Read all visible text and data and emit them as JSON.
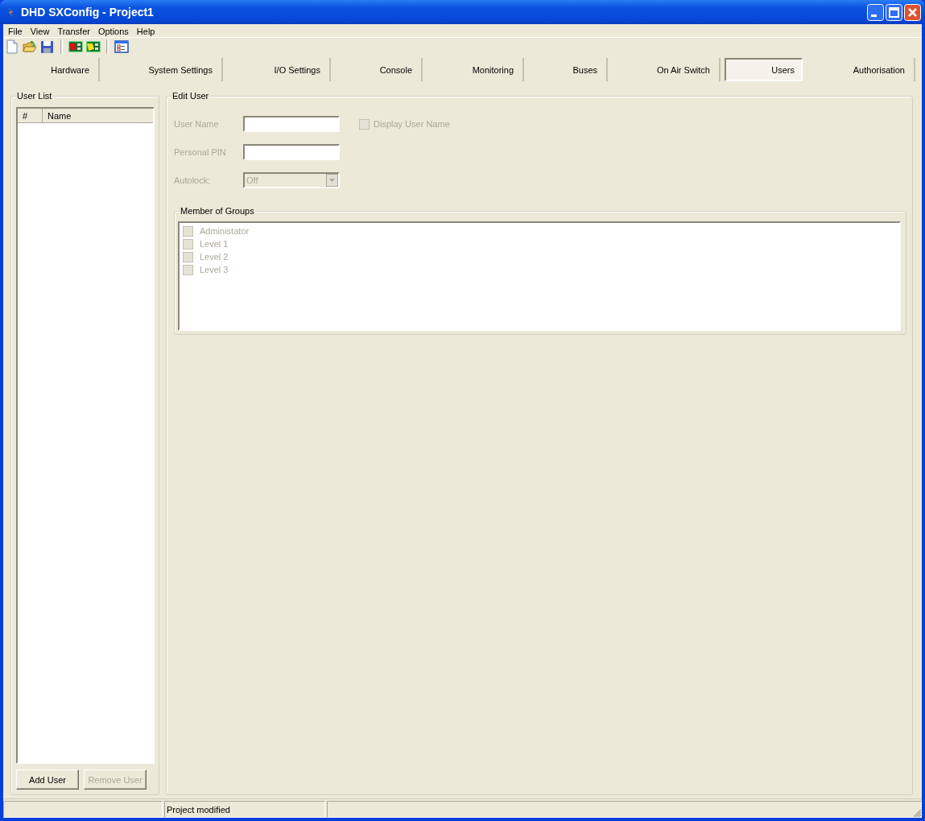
{
  "window": {
    "title": "DHD SXConfig - Project1"
  },
  "menu": [
    "File",
    "View",
    "Transfer",
    "Options",
    "Help"
  ],
  "toolbar": [
    {
      "kind": "new"
    },
    {
      "kind": "open"
    },
    {
      "kind": "save"
    },
    {
      "kind": "sep"
    },
    {
      "kind": "board-red"
    },
    {
      "kind": "board-yellow"
    },
    {
      "kind": "sep"
    },
    {
      "kind": "dialog"
    }
  ],
  "tabs": [
    {
      "label": "Hardware",
      "selected": false
    },
    {
      "label": "System Settings",
      "selected": false
    },
    {
      "label": "I/O Settings",
      "selected": false
    },
    {
      "label": "Console",
      "selected": false
    },
    {
      "label": "Monitoring",
      "selected": false
    },
    {
      "label": "Buses",
      "selected": false
    },
    {
      "label": "On Air Switch",
      "selected": false
    },
    {
      "label": "Users",
      "selected": true
    },
    {
      "label": "Authorisation",
      "selected": false
    }
  ],
  "user_list": {
    "title": "User List",
    "columns": [
      "#",
      "Name"
    ],
    "buttons": [
      {
        "label": "Add User",
        "disabled": false
      },
      {
        "label": "Remove User",
        "disabled": true
      }
    ]
  },
  "edit_user": {
    "title": "Edit User",
    "fields": [
      {
        "kind": "text",
        "label": "User Name",
        "disabled": true
      },
      {
        "kind": "text",
        "label": "Personal PIN",
        "disabled": true
      },
      {
        "kind": "dropdown",
        "label": "Autolock:",
        "value": "Off",
        "disabled": true
      }
    ],
    "display_user_name": {
      "label": "Display User Name",
      "checked": false,
      "disabled": true
    },
    "groups": {
      "title": "Member of Groups",
      "items": [
        {
          "label": "Administator",
          "checked": false,
          "disabled": true
        },
        {
          "label": "Level 1",
          "checked": false,
          "disabled": true
        },
        {
          "label": "Level 2",
          "checked": false,
          "disabled": true
        },
        {
          "label": "Level 3",
          "checked": false,
          "disabled": true
        }
      ]
    }
  },
  "status_bar": {
    "message": "Project modified"
  }
}
